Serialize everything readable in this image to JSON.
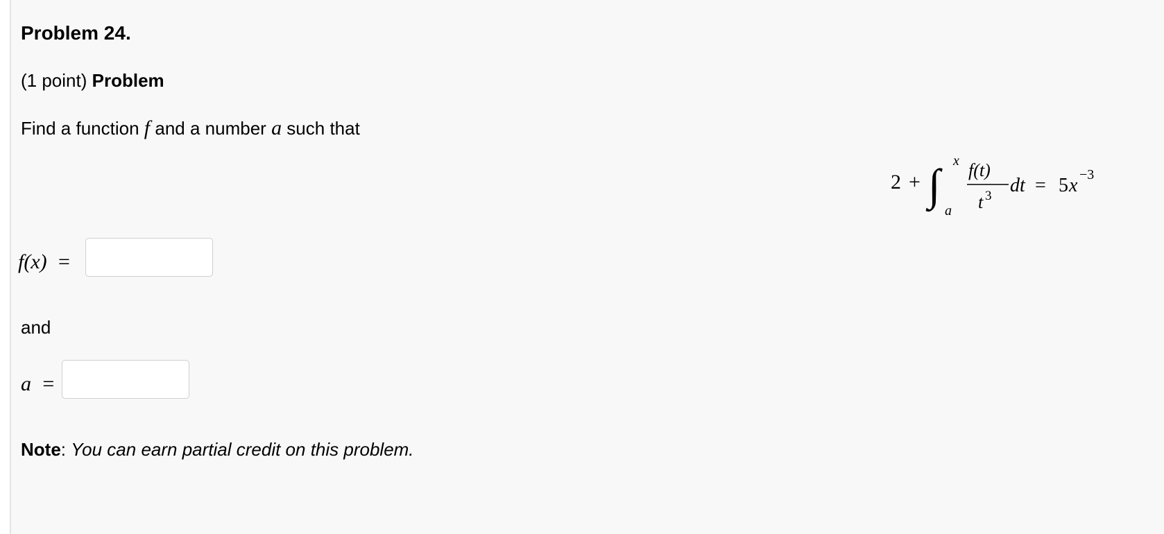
{
  "problem": {
    "title": "Problem 24.",
    "points": "(1 point)",
    "heading": "Problem",
    "intro_before_f": "Find a function",
    "intro_f": "f",
    "intro_middle": "and a number",
    "intro_a": "a",
    "intro_after": "such that"
  },
  "equation": {
    "constant": "2",
    "plus": "+",
    "upper_limit": "x",
    "lower_limit": "a",
    "numerator": "f(t)",
    "denominator_base": "t",
    "denominator_exp": "3",
    "differential": "dt",
    "equals": "=",
    "rhs_coef": "5",
    "rhs_var": "x",
    "rhs_exp": "−3"
  },
  "answers": {
    "f_label": "f(x)",
    "f_equals": "=",
    "f_value": "",
    "connector": "and",
    "a_label": "a",
    "a_equals": "=",
    "a_value": ""
  },
  "note": {
    "label": "Note",
    "colon": ":",
    "text": "You can earn partial credit on this problem."
  }
}
